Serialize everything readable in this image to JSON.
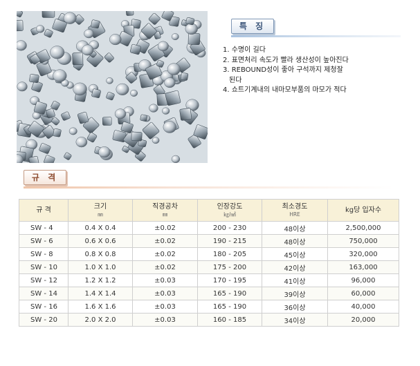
{
  "feature_section": {
    "title": "특 징"
  },
  "features": [
    {
      "text": "1. 수명이 길다"
    },
    {
      "text": "2. 표면처리 속도가 빨라 생산성이 높아진다"
    },
    {
      "text": "3. REBOUND성이 좋아 구석까지 제청잘",
      "continuation": "된다"
    },
    {
      "text": "4. 쇼트기계내의 내마모부품의 마모가 적다"
    }
  ],
  "spec_section": {
    "title": "규 격"
  },
  "table": {
    "headers": [
      {
        "label": "규  격",
        "unit": ""
      },
      {
        "label": "크기",
        "unit": "㎜"
      },
      {
        "label": "직경공차",
        "unit": "㎜"
      },
      {
        "label": "인장강도",
        "unit": "㎏/㎟"
      },
      {
        "label": "최소경도",
        "unit": "HRE"
      },
      {
        "label": "kg당 입자수",
        "unit": ""
      }
    ],
    "rows": [
      [
        "SW - 4",
        "0.4 X 0.4",
        "±0.02",
        "200 - 230",
        "48이상",
        "2,500,000"
      ],
      [
        "SW - 6",
        "0.6 X 0.6",
        "±0.02",
        "190 - 215",
        "48이상",
        "750,000"
      ],
      [
        "SW - 8",
        "0.8 X 0.8",
        "±0.02",
        "180 - 205",
        "45이상",
        "320,000"
      ],
      [
        "SW - 10",
        "1.0 X 1.0",
        "±0.02",
        "175 - 200",
        "42이상",
        "163,000"
      ],
      [
        "SW - 12",
        "1.2 X 1.2",
        "±0.03",
        "170 - 195",
        "41이상",
        "96,000"
      ],
      [
        "SW - 14",
        "1.4 X 1.4",
        "±0.03",
        "165 - 190",
        "39이상",
        "60,000"
      ],
      [
        "SW - 16",
        "1.6 X 1.6",
        "±0.03",
        "165 - 190",
        "36이상",
        "40,000"
      ],
      [
        "SW - 20",
        "2.0 X 2.0",
        "±0.03",
        "160 - 185",
        "34이상",
        "20,000"
      ]
    ]
  },
  "colors": {
    "feature_tab": "#3b557a",
    "spec_tab": "#8c4a2e",
    "table_header_bg": "#f8f1d8"
  }
}
